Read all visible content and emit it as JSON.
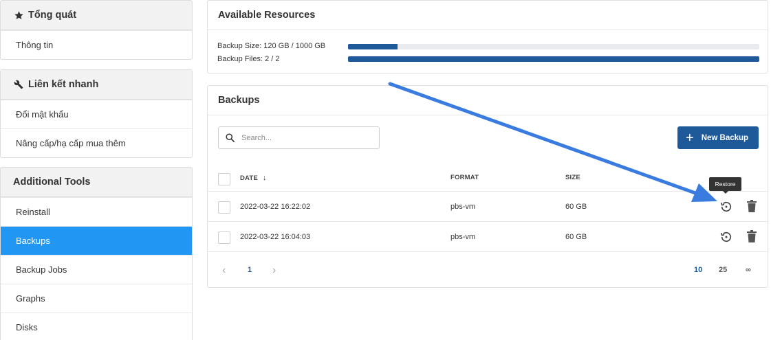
{
  "sidebar": {
    "overview": {
      "title": "Tổng quát",
      "icon": "star-icon",
      "items": [
        "Thông tin"
      ]
    },
    "quick_links": {
      "title": "Liên kết nhanh",
      "icon": "wrench-icon",
      "items": [
        "Đổi mật khẩu",
        "Nâng cấp/hạ cấp mua thêm"
      ]
    },
    "additional_tools": {
      "title": "Additional Tools",
      "items": [
        "Reinstall",
        "Backups",
        "Backup Jobs",
        "Graphs",
        "Disks"
      ],
      "active": "Backups"
    }
  },
  "resources": {
    "title": "Available Resources",
    "backup_size": {
      "label": "Backup Size: 120 GB / 1000 GB",
      "fraction": 0.12
    },
    "backup_files": {
      "label": "Backup Files: 2 / 2",
      "fraction": 1.0
    }
  },
  "backups": {
    "title": "Backups",
    "search_placeholder": "Search...",
    "new_backup_label": "New Backup",
    "columns": {
      "date": "DATE",
      "format": "FORMAT",
      "size": "SIZE"
    },
    "sort_icon": "arrow-down-icon",
    "rows": [
      {
        "date": "2022-03-22 16:22:02",
        "format": "pbs-vm",
        "size": "60 GB"
      },
      {
        "date": "2022-03-22 16:04:03",
        "format": "pbs-vm",
        "size": "60 GB"
      }
    ],
    "tooltip": "Restore",
    "pagination": {
      "current_page": "1",
      "page_sizes": [
        "10",
        "25",
        "∞"
      ],
      "selected_page_size": "10"
    }
  },
  "colors": {
    "accent": "#1e5a99",
    "sidebar_active": "#2196f3",
    "annotation_arrow": "#3a7be0"
  }
}
